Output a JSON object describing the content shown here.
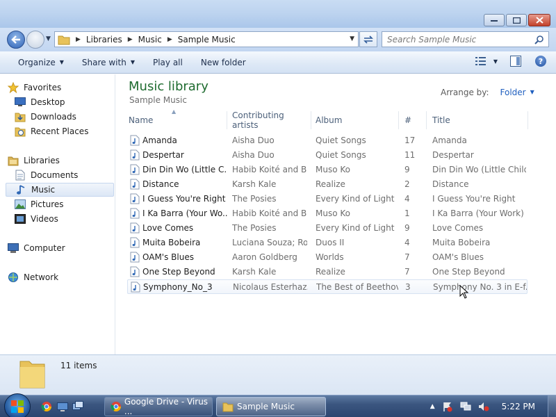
{
  "window": {
    "controls": {
      "minimize_icon": "minimize-icon",
      "maximize_icon": "maximize-icon",
      "close_icon": "close-icon"
    }
  },
  "address": {
    "crumbs": [
      "Libraries",
      "Music",
      "Sample Music"
    ]
  },
  "search": {
    "placeholder": "Search Sample Music"
  },
  "toolbar": {
    "organize": "Organize",
    "share_with": "Share with",
    "play_all": "Play all",
    "new_folder": "New folder"
  },
  "nav": {
    "favorites": "Favorites",
    "desktop": "Desktop",
    "downloads": "Downloads",
    "recent_places": "Recent Places",
    "libraries": "Libraries",
    "documents": "Documents",
    "music": "Music",
    "pictures": "Pictures",
    "videos": "Videos",
    "computer": "Computer",
    "network": "Network"
  },
  "library": {
    "title": "Music library",
    "subtitle": "Sample Music",
    "arrange_label": "Arrange by:",
    "arrange_value": "Folder"
  },
  "columns": {
    "name": "Name",
    "artists": "Contributing artists",
    "album": "Album",
    "number": "#",
    "title": "Title"
  },
  "files": [
    {
      "name": "Amanda",
      "artist": "Aisha Duo",
      "album": "Quiet Songs",
      "num": "17",
      "title": "Amanda"
    },
    {
      "name": "Despertar",
      "artist": "Aisha Duo",
      "album": "Quiet Songs",
      "num": "11",
      "title": "Despertar"
    },
    {
      "name": "Din Din Wo (Little C...",
      "artist": "Habib Koité and B...",
      "album": "Muso Ko",
      "num": "9",
      "title": "Din Din Wo (Little Child)"
    },
    {
      "name": "Distance",
      "artist": "Karsh Kale",
      "album": "Realize",
      "num": "2",
      "title": "Distance"
    },
    {
      "name": "I Guess You're Right",
      "artist": "The Posies",
      "album": "Every Kind of Light",
      "num": "4",
      "title": "I Guess You're Right"
    },
    {
      "name": "I Ka Barra (Your Wo...",
      "artist": "Habib Koité and B...",
      "album": "Muso Ko",
      "num": "1",
      "title": "I Ka Barra (Your Work)"
    },
    {
      "name": "Love Comes",
      "artist": "The Posies",
      "album": "Every Kind of Light",
      "num": "9",
      "title": "Love Comes"
    },
    {
      "name": "Muita Bobeira",
      "artist": "Luciana Souza; Ro...",
      "album": "Duos II",
      "num": "4",
      "title": "Muita Bobeira"
    },
    {
      "name": "OAM's Blues",
      "artist": "Aaron Goldberg",
      "album": "Worlds",
      "num": "7",
      "title": "OAM's Blues"
    },
    {
      "name": "One Step Beyond",
      "artist": "Karsh Kale",
      "album": "Realize",
      "num": "7",
      "title": "One Step Beyond"
    },
    {
      "name": "Symphony_No_3",
      "artist": "Nicolaus Esterhaz...",
      "album": "The Best of Beethov...",
      "num": "3",
      "title": "Symphony No. 3 in E-f..."
    }
  ],
  "details": {
    "count": "11 items"
  },
  "taskbar": {
    "items": [
      "Google Drive - Virus ...",
      "Sample Music"
    ],
    "clock": "5:22 PM"
  },
  "colors": {
    "library_title": "#1e6b2f",
    "link": "#1f5fbf",
    "taskbar": "#2c4670"
  }
}
